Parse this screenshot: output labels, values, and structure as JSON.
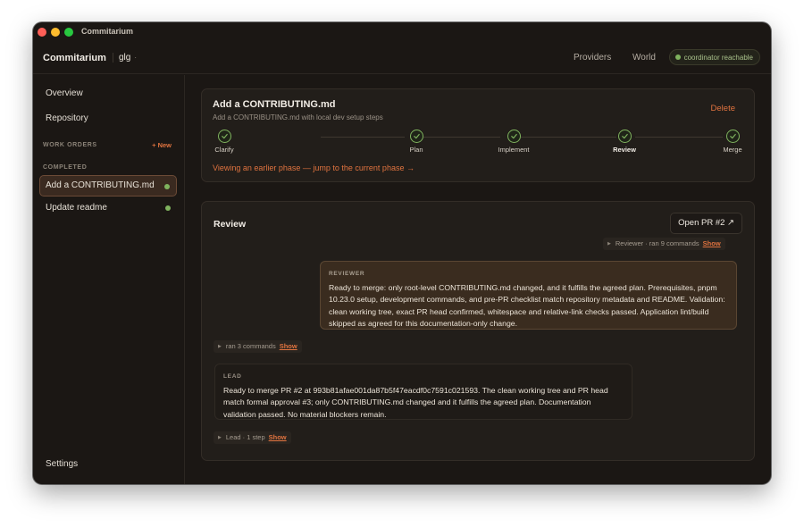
{
  "window": {
    "title": "Commitarium"
  },
  "header": {
    "brand": "Commitarium",
    "workspace": "glg",
    "workspace_caret": "·",
    "nav": [
      "Providers",
      "World"
    ],
    "status": "coordinator reachable",
    "status_color": "#7fb35e"
  },
  "sidebar": {
    "overview": "Overview",
    "repository": "Repository",
    "work_orders_label": "WORK ORDERS",
    "new_label": "+ New",
    "completed_label": "COMPLETED",
    "items": [
      {
        "label": "Add a CONTRIBUTING.md",
        "active": true
      },
      {
        "label": "Update readme",
        "active": false
      }
    ],
    "settings": "Settings"
  },
  "work_order": {
    "title": "Add a CONTRIBUTING.md",
    "subtitle": "Add a CONTRIBUTING.md with local dev setup steps",
    "delete_label": "Delete",
    "phases": [
      {
        "label": "Clarify",
        "done": true
      },
      {
        "label": "Plan",
        "done": true
      },
      {
        "label": "Implement",
        "done": true
      },
      {
        "label": "Review",
        "done": true,
        "current": true
      },
      {
        "label": "Merge",
        "done": true
      }
    ],
    "jump_link": "Viewing an earlier phase — jump to the current phase →"
  },
  "review": {
    "title": "Review",
    "open_pr": "Open PR #2 ↗",
    "reviewer_commands": "Reviewer · ran 9 commands",
    "reviewer_label": "REVIEWER",
    "reviewer_text": "Ready to merge: only root-level CONTRIBUTING.md changed, and it fulfills the agreed plan. Prerequisites, pnpm 10.23.0 setup, development commands, and pre-PR checklist match repository metadata and README. Validation: clean working tree, exact PR head confirmed, whitespace and relative-link checks passed. Application lint/build skipped as agreed for this documentation-only change.",
    "ran_commands": "ran 3 commands",
    "lead_label": "LEAD",
    "lead_text": "Ready to merge PR #2 at 993b81afae001da87b5f47eacdf0c7591c021593. The clean working tree and PR head match formal approval #3; only CONTRIBUTING.md changed and it fulfills the agreed plan. Documentation validation passed. No material blockers remain.",
    "lead_steps": "Lead · 1 step",
    "show_label": "Show"
  },
  "colors": {
    "accent": "#e0733f",
    "success": "#7fb35e",
    "background": "#1b1714"
  }
}
